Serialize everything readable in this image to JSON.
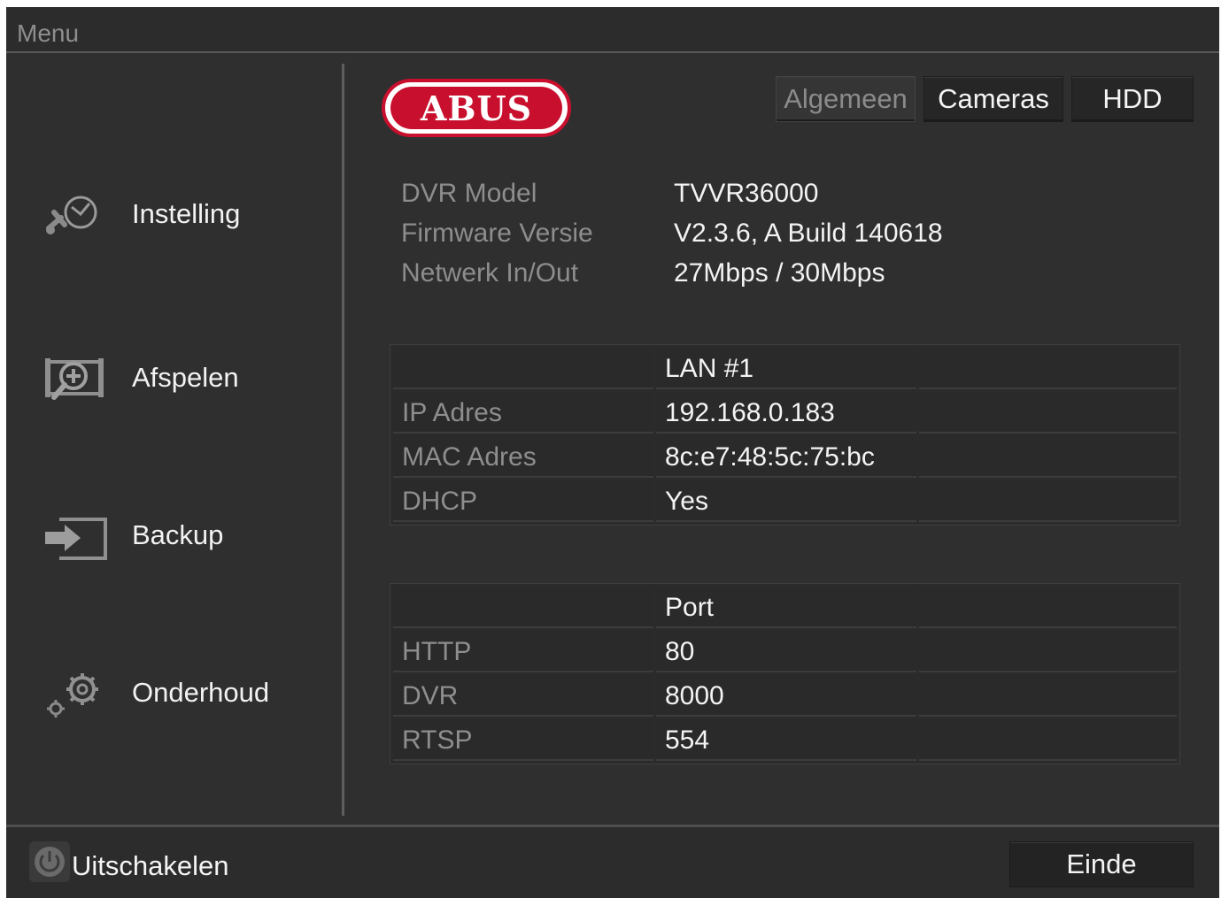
{
  "window": {
    "title": "Menu"
  },
  "sidebar": {
    "items": [
      {
        "label": "Instelling",
        "icon": "settings-tools-icon"
      },
      {
        "label": "Afspelen",
        "icon": "playback-icon"
      },
      {
        "label": "Backup",
        "icon": "backup-icon"
      },
      {
        "label": "Onderhoud",
        "icon": "maintenance-gears-icon"
      }
    ]
  },
  "logo": {
    "text": "ABUS",
    "color": "#c8102e"
  },
  "tabs": [
    {
      "label": "Algemeen",
      "active": true
    },
    {
      "label": "Cameras",
      "active": false
    },
    {
      "label": "HDD",
      "active": false
    }
  ],
  "info": [
    {
      "key": "DVR Model",
      "value": "TVVR36000"
    },
    {
      "key": "Firmware Versie",
      "value": "V2.3.6, A Build 140618"
    },
    {
      "key": "Netwerk In/Out",
      "value": "27Mbps / 30Mbps"
    }
  ],
  "network_table": {
    "header": [
      "",
      "LAN #1",
      ""
    ],
    "rows": [
      [
        "IP Adres",
        "192.168.0.183",
        ""
      ],
      [
        "MAC Adres",
        "8c:e7:48:5c:75:bc",
        ""
      ],
      [
        "DHCP",
        "Yes",
        ""
      ]
    ]
  },
  "port_table": {
    "header": [
      "",
      "Port",
      ""
    ],
    "rows": [
      [
        "HTTP",
        "80",
        ""
      ],
      [
        "DVR",
        "8000",
        ""
      ],
      [
        "RTSP",
        "554",
        ""
      ]
    ]
  },
  "footer": {
    "power_label": "Uitschakelen",
    "exit_label": "Einde"
  }
}
